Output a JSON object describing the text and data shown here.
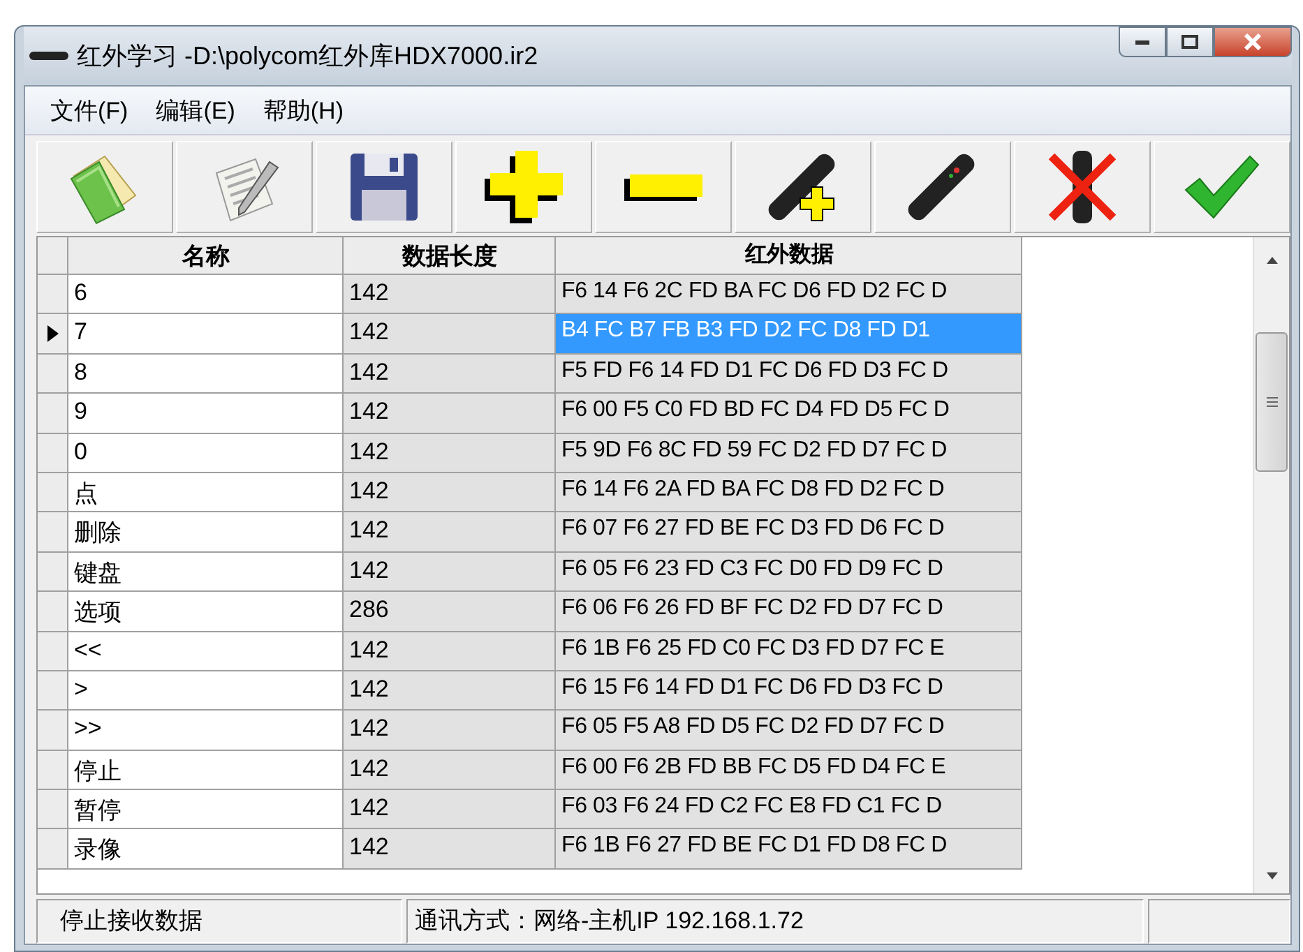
{
  "window": {
    "title": "红外学习 -D:\\polycom红外库HDX7000.ir2"
  },
  "menu": [
    {
      "label": "文件(F)"
    },
    {
      "label": "编辑(E)"
    },
    {
      "label": "帮助(H)"
    }
  ],
  "table": {
    "columns": [
      "名称",
      "数据长度",
      "红外数据"
    ],
    "rows": [
      {
        "name": "6",
        "length": "142",
        "data": "F6 14 F6 2C FD BA FC D6 FD D2 FC D",
        "selected": false
      },
      {
        "name": "7",
        "length": "142",
        "data": "B4 FC B7 FB B3 FD D2 FC D8 FD D1",
        "selected": true
      },
      {
        "name": "8",
        "length": "142",
        "data": "F5 FD F6 14 FD D1 FC D6 FD D3 FC D",
        "selected": false
      },
      {
        "name": "9",
        "length": "142",
        "data": "F6 00 F5 C0 FD BD FC D4 FD D5 FC D",
        "selected": false
      },
      {
        "name": "0",
        "length": "142",
        "data": "F5 9D F6 8C FD 59 FC D2 FD D7 FC D",
        "selected": false
      },
      {
        "name": "点",
        "length": "142",
        "data": "F6 14 F6 2A FD BA FC D8 FD D2 FC D",
        "selected": false
      },
      {
        "name": "删除",
        "length": "142",
        "data": "F6 07 F6 27 FD BE FC D3 FD D6 FC D",
        "selected": false
      },
      {
        "name": "键盘",
        "length": "142",
        "data": "F6 05 F6 23 FD C3 FC D0 FD D9 FC D",
        "selected": false
      },
      {
        "name": "选项",
        "length": "286",
        "data": "F6 06 F6 26 FD BF FC D2 FD D7 FC D",
        "selected": false
      },
      {
        "name": "<<",
        "length": "142",
        "data": "F6 1B F6 25 FD C0 FC D3 FD D7 FC E",
        "selected": false
      },
      {
        "name": ">",
        "length": "142",
        "data": "F6 15 F6 14 FD D1 FC D6 FD D3 FC D",
        "selected": false
      },
      {
        "name": ">>",
        "length": "142",
        "data": "F6 05 F5 A8 FD D5 FC D2 FD D7 FC D",
        "selected": false
      },
      {
        "name": "停止",
        "length": "142",
        "data": "F6 00 F6 2B FD BB FC D5 FD D4 FC E",
        "selected": false
      },
      {
        "name": "暂停",
        "length": "142",
        "data": "F6 03 F6 24 FD C2 FC E8 FD C1 FC D",
        "selected": false
      },
      {
        "name": "录像",
        "length": "142",
        "data": "F6 1B F6 27 FD BE FC D1 FD D8 FC D",
        "selected": false
      }
    ]
  },
  "status_bar": [
    "停止接收数据",
    "通讯方式：网络-主机IP 192.168.1.72"
  ]
}
